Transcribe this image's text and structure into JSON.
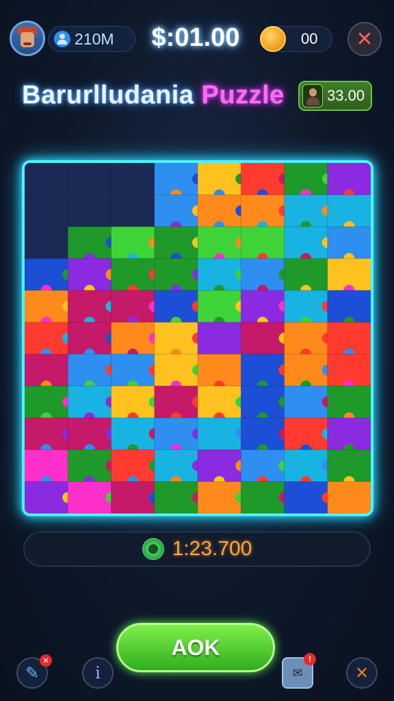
{
  "header": {
    "users_count": "210M",
    "timer": "$:01.00",
    "coins": "00",
    "avatar_icon": "player-avatar",
    "users_icon": "user-icon",
    "coin_icon": "coin-icon",
    "close_icon": "close-icon"
  },
  "title": {
    "part1": "Barurlludania",
    "part2": "Puzzle"
  },
  "badge": {
    "value": "33.00",
    "icon": "character-icon"
  },
  "board": {
    "rows": 11,
    "cols": 8,
    "accent": "#4ff3ff"
  },
  "stats": {
    "value": "1:23.700",
    "icon": "ring-coin-icon"
  },
  "ok_button": {
    "label": "AOK"
  },
  "bottom_bar": {
    "items": [
      {
        "name": "brush-icon",
        "badge": "x"
      },
      {
        "name": "info-icon",
        "glyph": "i"
      },
      {
        "name": "chest-icon",
        "badge": "!"
      },
      {
        "name": "tools-icon"
      }
    ]
  }
}
